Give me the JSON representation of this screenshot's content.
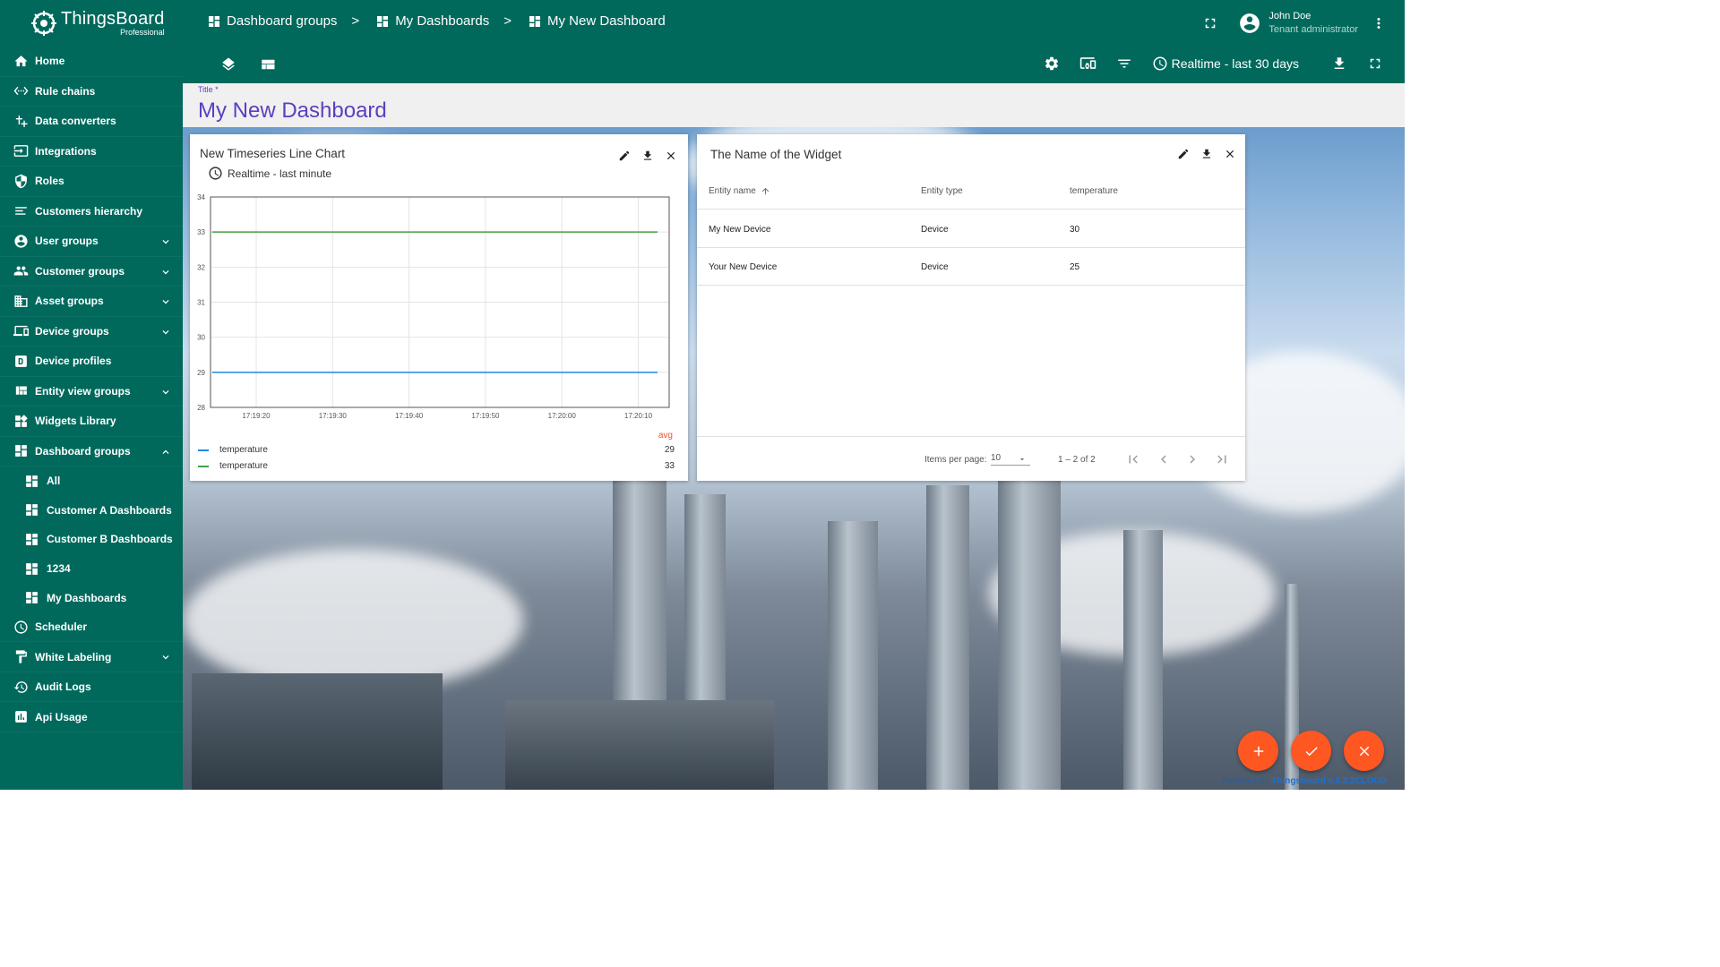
{
  "logo": {
    "name": "ThingsBoard",
    "sub": "Professional"
  },
  "sidebar": {
    "items": [
      {
        "label": "Home",
        "icon": "home-icon"
      },
      {
        "label": "Rule chains",
        "icon": "rule-chains-icon"
      },
      {
        "label": "Data converters",
        "icon": "converter-icon"
      },
      {
        "label": "Integrations",
        "icon": "integrations-icon"
      },
      {
        "label": "Roles",
        "icon": "shield-icon"
      },
      {
        "label": "Customers hierarchy",
        "icon": "hierarchy-icon"
      },
      {
        "label": "User groups",
        "icon": "account-icon",
        "expandable": true
      },
      {
        "label": "Customer groups",
        "icon": "people-icon",
        "expandable": true
      },
      {
        "label": "Asset groups",
        "icon": "building-icon",
        "expandable": true
      },
      {
        "label": "Device groups",
        "icon": "devices-icon",
        "expandable": true
      },
      {
        "label": "Device profiles",
        "icon": "device-profile-icon"
      },
      {
        "label": "Entity view groups",
        "icon": "view-quilt-icon",
        "expandable": true
      },
      {
        "label": "Widgets Library",
        "icon": "widgets-icon"
      },
      {
        "label": "Dashboard groups",
        "icon": "dashboard-icon",
        "expanded": true
      }
    ],
    "sub_items": [
      {
        "label": "All"
      },
      {
        "label": "Customer A Dashboards"
      },
      {
        "label": "Customer B Dashboards"
      },
      {
        "label": "1234"
      },
      {
        "label": "My Dashboards"
      }
    ],
    "items_after": [
      {
        "label": "Scheduler",
        "icon": "clock-icon"
      },
      {
        "label": "White Labeling",
        "icon": "format-paint-icon",
        "expandable": true
      },
      {
        "label": "Audit Logs",
        "icon": "audit-icon"
      },
      {
        "label": "Api Usage",
        "icon": "insert-chart-icon"
      }
    ]
  },
  "header": {
    "breadcrumbs": [
      "Dashboard groups",
      "My Dashboards",
      "My New Dashboard"
    ],
    "separator": ">",
    "user": {
      "name": "John Doe",
      "role": "Tenant administrator"
    },
    "timewindow": "Realtime - last 30 days"
  },
  "title_field": {
    "label": "Title *",
    "value": "My New Dashboard"
  },
  "chart_widget": {
    "title": "New Timeseries Line Chart",
    "timewindow": "Realtime - last minute",
    "legend_header": "avg",
    "legend": [
      {
        "label": "temperature",
        "value": "29",
        "color": "#1e88e5"
      },
      {
        "label": "temperature",
        "value": "33",
        "color": "#43a047"
      }
    ]
  },
  "chart_data": {
    "type": "line",
    "x": [
      "17:19:20",
      "17:19:30",
      "17:19:40",
      "17:19:50",
      "17:20:00",
      "17:20:10"
    ],
    "ylim": [
      28,
      34
    ],
    "yticks": [
      28,
      29,
      30,
      31,
      32,
      33,
      34
    ],
    "series": [
      {
        "name": "temperature",
        "values": [
          29,
          29,
          29,
          29,
          29,
          29
        ],
        "color": "#1e88e5"
      },
      {
        "name": "temperature",
        "values": [
          33,
          33,
          33,
          33,
          33,
          33
        ],
        "color": "#43a047"
      }
    ]
  },
  "table_widget": {
    "title": "The Name of the Widget",
    "columns": [
      "Entity name",
      "Entity type",
      "temperature"
    ],
    "rows": [
      [
        "My New Device",
        "Device",
        "30"
      ],
      [
        "Your New Device",
        "Device",
        "25"
      ]
    ],
    "paginator": {
      "items_per_page_label": "Items per page:",
      "items_per_page": "10",
      "range": "1 – 2 of 2"
    }
  },
  "footer": {
    "powered": "Powered by ",
    "brand": "Thingsboard",
    "version": " v.3.2.2CLOUD"
  }
}
